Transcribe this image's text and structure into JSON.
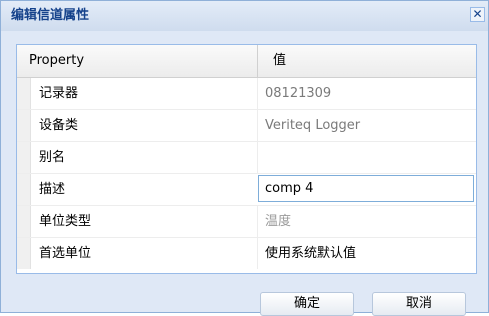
{
  "window": {
    "title": "编辑信道属性",
    "close_glyph": "✕"
  },
  "grid": {
    "columns": [
      "Property",
      "值"
    ],
    "rows": [
      {
        "name": "记录器",
        "value": "08121309"
      },
      {
        "name": "设备类",
        "value": "Veriteq Logger"
      },
      {
        "name": "别名",
        "value": ""
      },
      {
        "name": "描述",
        "value": "comp 4"
      },
      {
        "name": "单位类型",
        "value": "温度"
      },
      {
        "name": "首选单位",
        "value": "使用系统默认值"
      }
    ]
  },
  "buttons": {
    "ok_label": "确定",
    "cancel_label": "取消"
  },
  "icons": {
    "close": "close-icon"
  }
}
